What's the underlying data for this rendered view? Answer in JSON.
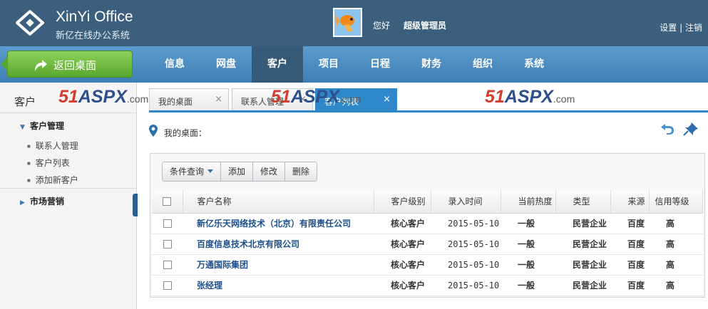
{
  "header": {
    "brand_title": "XinYi Office",
    "brand_subtitle": "新亿在线办公系统",
    "greeting": "您好",
    "username": "超级管理员",
    "settings_link": "设置",
    "link_separator": "|",
    "logout_link": "注销"
  },
  "nav": {
    "back_label": "返回桌面",
    "items": [
      {
        "label": "信息"
      },
      {
        "label": "网盘"
      },
      {
        "label": "客户",
        "active": true
      },
      {
        "label": "项目"
      },
      {
        "label": "日程"
      },
      {
        "label": "财务"
      },
      {
        "label": "组织"
      },
      {
        "label": "系统"
      }
    ]
  },
  "sidebar": {
    "title": "客户",
    "groups": [
      {
        "label": "客户管理",
        "expanded": true,
        "items": [
          "联系人管理",
          "客户列表",
          "添加新客户"
        ]
      },
      {
        "label": "市场营销",
        "expanded": false,
        "items": []
      }
    ]
  },
  "watermark": {
    "number": "51",
    "brand": "ASPX",
    "tld": ".com"
  },
  "tabs": [
    {
      "label": "我的桌面",
      "close": "×"
    },
    {
      "label": "联系人管理",
      "close": "×"
    },
    {
      "label": "客户列表",
      "close": "×",
      "active": true
    }
  ],
  "breadcrumb": {
    "text": "我的桌面："
  },
  "toolbar": {
    "query_label": "条件查询",
    "add_label": "添加",
    "edit_label": "修改",
    "delete_label": "删除"
  },
  "table": {
    "columns": [
      "客户名称",
      "客户级别",
      "录入时间",
      "当前热度",
      "类型",
      "来源",
      "信用等级"
    ],
    "rows": [
      [
        "新亿乐天网络技术（北京）有限责任公司",
        "核心客户",
        "2015-05-10",
        "一般",
        "民营企业",
        "百度",
        "高"
      ],
      [
        "百度信息技术北京有限公司",
        "核心客户",
        "2015-05-10",
        "一般",
        "民营企业",
        "百度",
        "高"
      ],
      [
        "万通国际集团",
        "核心客户",
        "2015-05-10",
        "一般",
        "民营企业",
        "百度",
        "高"
      ],
      [
        "张经理",
        "核心客户",
        "2015-05-10",
        "一般",
        "民营企业",
        "百度",
        "高"
      ]
    ]
  },
  "colors": {
    "header_bg": "#3b5f7c",
    "nav_bg": "#4f8fc2",
    "nav_active": "#355a78",
    "back_button": "#6cb83a",
    "tab_active": "#2e87c8",
    "link_text": "#1d4f8a"
  }
}
